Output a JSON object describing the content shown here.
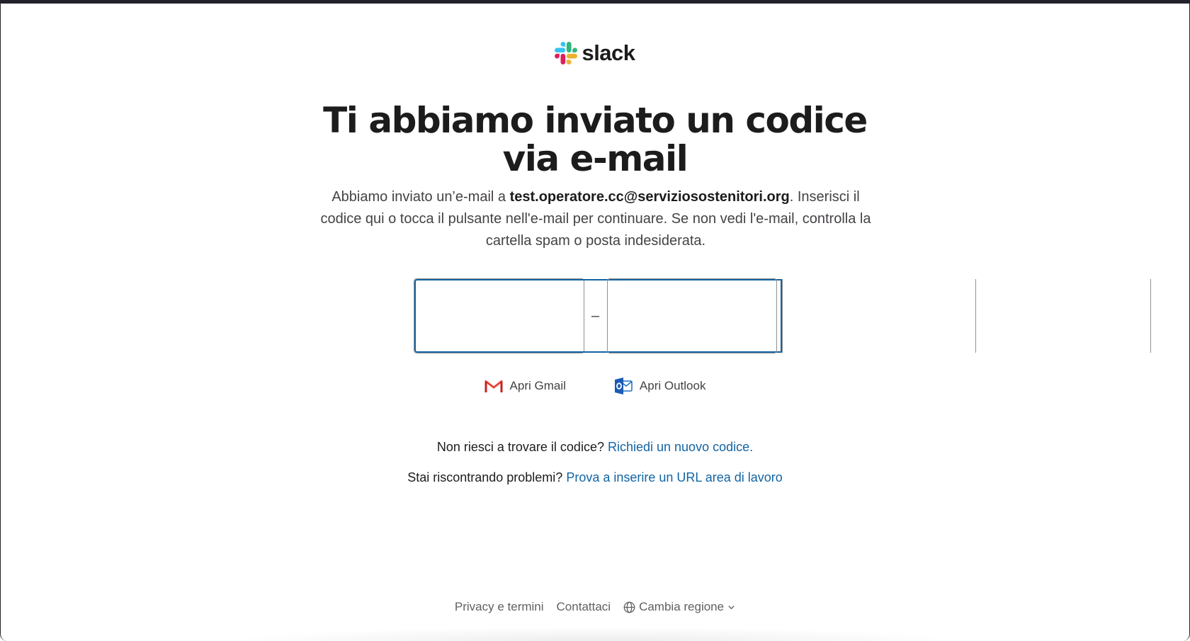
{
  "logo": {
    "text": "slack",
    "colors": {
      "blue": "#36C5F0",
      "green": "#2EB67D",
      "yellow": "#ECB22E",
      "red": "#E01E5A"
    }
  },
  "title": {
    "line1": "Ti abbiamo inviato un codice",
    "line2": "via e-mail"
  },
  "subtitle": {
    "prefix": "Abbiamo inviato un’e-mail a ",
    "email": "test.operatore.cc@serviziosostenitori.org",
    "suffix": ". Inserisci il codice qui o tocca il pulsante nell'e-mail per continuare. Se non vedi l'e-mail, controlla la cartella spam o posta indesiderata."
  },
  "code": {
    "group1": [
      "",
      "",
      ""
    ],
    "group2": [
      "",
      "",
      ""
    ],
    "separator": "–",
    "active_index": 0
  },
  "mail_links": {
    "gmail": {
      "label": "Apri Gmail",
      "icon": "gmail-icon"
    },
    "outlook": {
      "label": "Apri Outlook",
      "icon": "outlook-icon"
    }
  },
  "help": {
    "not_found_text": "Non riesci a trovare il codice?",
    "not_found_link": "Richiedi un nuovo codice.",
    "problems_text": "Stai riscontrando problemi?",
    "problems_link": "Prova a inserire un URL area di lavoro"
  },
  "footer": {
    "privacy": "Privacy e termini",
    "contact": "Contattaci",
    "region": "Cambia regione",
    "region_icon": "globe-icon",
    "region_chevron": "chevron-down-icon"
  },
  "colors": {
    "link": "#1264a3",
    "text_dark": "#1d1c1d",
    "text_muted": "#454245",
    "focus": "#1264a3"
  }
}
